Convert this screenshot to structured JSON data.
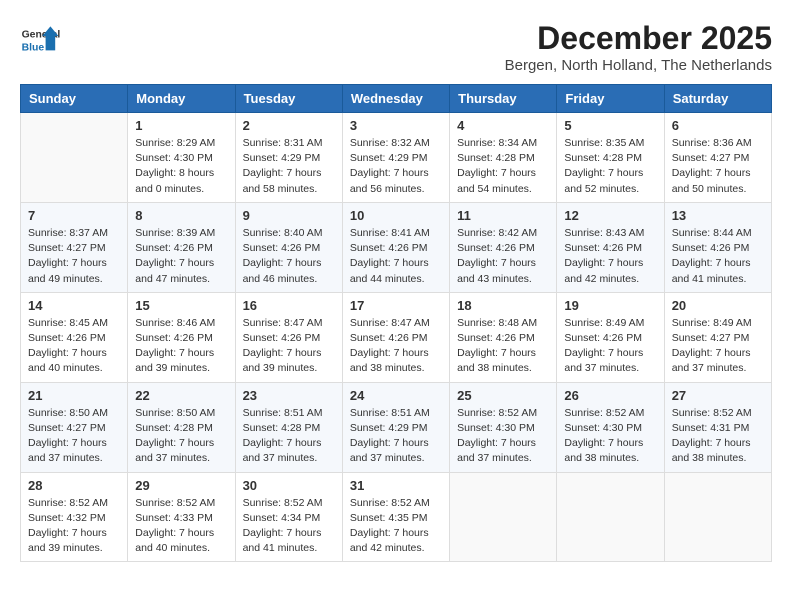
{
  "header": {
    "logo_general": "General",
    "logo_blue": "Blue",
    "month_title": "December 2025",
    "subtitle": "Bergen, North Holland, The Netherlands"
  },
  "calendar": {
    "days_of_week": [
      "Sunday",
      "Monday",
      "Tuesday",
      "Wednesday",
      "Thursday",
      "Friday",
      "Saturday"
    ],
    "weeks": [
      [
        {
          "day": "",
          "info": ""
        },
        {
          "day": "1",
          "info": "Sunrise: 8:29 AM\nSunset: 4:30 PM\nDaylight: 8 hours\nand 0 minutes."
        },
        {
          "day": "2",
          "info": "Sunrise: 8:31 AM\nSunset: 4:29 PM\nDaylight: 7 hours\nand 58 minutes."
        },
        {
          "day": "3",
          "info": "Sunrise: 8:32 AM\nSunset: 4:29 PM\nDaylight: 7 hours\nand 56 minutes."
        },
        {
          "day": "4",
          "info": "Sunrise: 8:34 AM\nSunset: 4:28 PM\nDaylight: 7 hours\nand 54 minutes."
        },
        {
          "day": "5",
          "info": "Sunrise: 8:35 AM\nSunset: 4:28 PM\nDaylight: 7 hours\nand 52 minutes."
        },
        {
          "day": "6",
          "info": "Sunrise: 8:36 AM\nSunset: 4:27 PM\nDaylight: 7 hours\nand 50 minutes."
        }
      ],
      [
        {
          "day": "7",
          "info": "Sunrise: 8:37 AM\nSunset: 4:27 PM\nDaylight: 7 hours\nand 49 minutes."
        },
        {
          "day": "8",
          "info": "Sunrise: 8:39 AM\nSunset: 4:26 PM\nDaylight: 7 hours\nand 47 minutes."
        },
        {
          "day": "9",
          "info": "Sunrise: 8:40 AM\nSunset: 4:26 PM\nDaylight: 7 hours\nand 46 minutes."
        },
        {
          "day": "10",
          "info": "Sunrise: 8:41 AM\nSunset: 4:26 PM\nDaylight: 7 hours\nand 44 minutes."
        },
        {
          "day": "11",
          "info": "Sunrise: 8:42 AM\nSunset: 4:26 PM\nDaylight: 7 hours\nand 43 minutes."
        },
        {
          "day": "12",
          "info": "Sunrise: 8:43 AM\nSunset: 4:26 PM\nDaylight: 7 hours\nand 42 minutes."
        },
        {
          "day": "13",
          "info": "Sunrise: 8:44 AM\nSunset: 4:26 PM\nDaylight: 7 hours\nand 41 minutes."
        }
      ],
      [
        {
          "day": "14",
          "info": "Sunrise: 8:45 AM\nSunset: 4:26 PM\nDaylight: 7 hours\nand 40 minutes."
        },
        {
          "day": "15",
          "info": "Sunrise: 8:46 AM\nSunset: 4:26 PM\nDaylight: 7 hours\nand 39 minutes."
        },
        {
          "day": "16",
          "info": "Sunrise: 8:47 AM\nSunset: 4:26 PM\nDaylight: 7 hours\nand 39 minutes."
        },
        {
          "day": "17",
          "info": "Sunrise: 8:47 AM\nSunset: 4:26 PM\nDaylight: 7 hours\nand 38 minutes."
        },
        {
          "day": "18",
          "info": "Sunrise: 8:48 AM\nSunset: 4:26 PM\nDaylight: 7 hours\nand 38 minutes."
        },
        {
          "day": "19",
          "info": "Sunrise: 8:49 AM\nSunset: 4:26 PM\nDaylight: 7 hours\nand 37 minutes."
        },
        {
          "day": "20",
          "info": "Sunrise: 8:49 AM\nSunset: 4:27 PM\nDaylight: 7 hours\nand 37 minutes."
        }
      ],
      [
        {
          "day": "21",
          "info": "Sunrise: 8:50 AM\nSunset: 4:27 PM\nDaylight: 7 hours\nand 37 minutes."
        },
        {
          "day": "22",
          "info": "Sunrise: 8:50 AM\nSunset: 4:28 PM\nDaylight: 7 hours\nand 37 minutes."
        },
        {
          "day": "23",
          "info": "Sunrise: 8:51 AM\nSunset: 4:28 PM\nDaylight: 7 hours\nand 37 minutes."
        },
        {
          "day": "24",
          "info": "Sunrise: 8:51 AM\nSunset: 4:29 PM\nDaylight: 7 hours\nand 37 minutes."
        },
        {
          "day": "25",
          "info": "Sunrise: 8:52 AM\nSunset: 4:30 PM\nDaylight: 7 hours\nand 37 minutes."
        },
        {
          "day": "26",
          "info": "Sunrise: 8:52 AM\nSunset: 4:30 PM\nDaylight: 7 hours\nand 38 minutes."
        },
        {
          "day": "27",
          "info": "Sunrise: 8:52 AM\nSunset: 4:31 PM\nDaylight: 7 hours\nand 38 minutes."
        }
      ],
      [
        {
          "day": "28",
          "info": "Sunrise: 8:52 AM\nSunset: 4:32 PM\nDaylight: 7 hours\nand 39 minutes."
        },
        {
          "day": "29",
          "info": "Sunrise: 8:52 AM\nSunset: 4:33 PM\nDaylight: 7 hours\nand 40 minutes."
        },
        {
          "day": "30",
          "info": "Sunrise: 8:52 AM\nSunset: 4:34 PM\nDaylight: 7 hours\nand 41 minutes."
        },
        {
          "day": "31",
          "info": "Sunrise: 8:52 AM\nSunset: 4:35 PM\nDaylight: 7 hours\nand 42 minutes."
        },
        {
          "day": "",
          "info": ""
        },
        {
          "day": "",
          "info": ""
        },
        {
          "day": "",
          "info": ""
        }
      ]
    ]
  }
}
